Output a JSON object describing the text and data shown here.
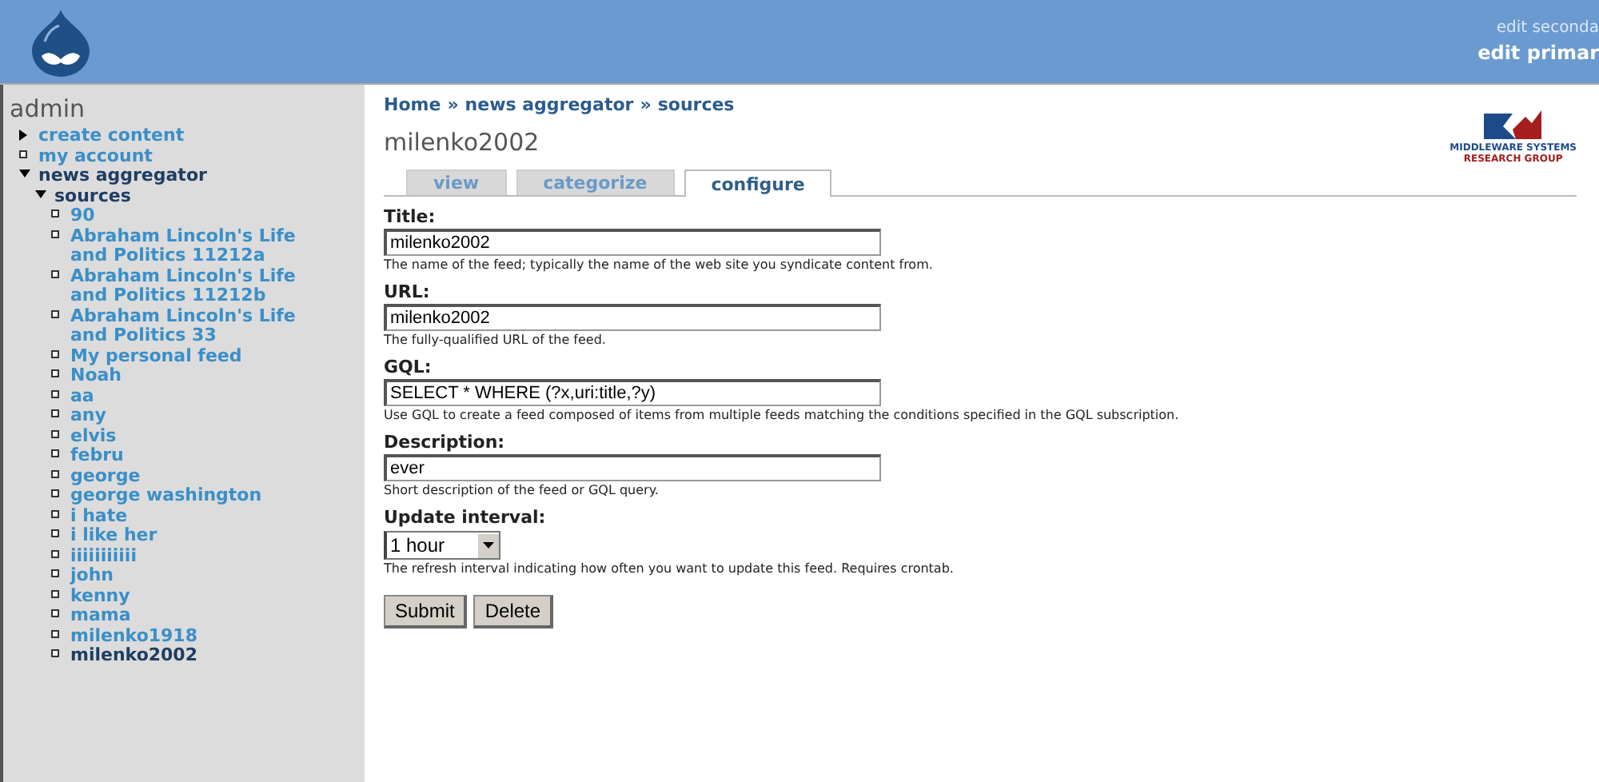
{
  "header": {
    "secondary_link": "edit seconda",
    "primary_link": "edit primar"
  },
  "sidebar": {
    "title": "admin",
    "items": [
      {
        "label": "create content",
        "kind": "collapsed",
        "active": false
      },
      {
        "label": "my account",
        "kind": "leaf",
        "active": false
      },
      {
        "label": "news aggregator",
        "kind": "expanded",
        "active": true,
        "children": [
          {
            "label": "sources",
            "kind": "expanded",
            "active": true,
            "children": [
              {
                "label": "90",
                "kind": "leaf",
                "active": false
              },
              {
                "label": "Abraham Lincoln's Life and Politics 11212a",
                "kind": "leaf",
                "active": false
              },
              {
                "label": "Abraham Lincoln's Life and Politics 11212b",
                "kind": "leaf",
                "active": false
              },
              {
                "label": "Abraham Lincoln's Life and Politics 33",
                "kind": "leaf",
                "active": false
              },
              {
                "label": "My personal feed",
                "kind": "leaf",
                "active": false
              },
              {
                "label": "Noah",
                "kind": "leaf",
                "active": false
              },
              {
                "label": "aa",
                "kind": "leaf",
                "active": false
              },
              {
                "label": "any",
                "kind": "leaf",
                "active": false
              },
              {
                "label": "elvis",
                "kind": "leaf",
                "active": false
              },
              {
                "label": "febru",
                "kind": "leaf",
                "active": false
              },
              {
                "label": "george",
                "kind": "leaf",
                "active": false
              },
              {
                "label": "george washington",
                "kind": "leaf",
                "active": false
              },
              {
                "label": "i hate",
                "kind": "leaf",
                "active": false
              },
              {
                "label": "i like her",
                "kind": "leaf",
                "active": false
              },
              {
                "label": "iiiiiiiiiii",
                "kind": "leaf",
                "active": false
              },
              {
                "label": "john",
                "kind": "leaf",
                "active": false
              },
              {
                "label": "kenny",
                "kind": "leaf",
                "active": false
              },
              {
                "label": "mama",
                "kind": "leaf",
                "active": false
              },
              {
                "label": "milenko1918",
                "kind": "leaf",
                "active": false
              },
              {
                "label": "milenko2002",
                "kind": "leaf",
                "active": true
              }
            ]
          }
        ]
      }
    ]
  },
  "breadcrumb": [
    "Home",
    "news aggregator",
    "sources"
  ],
  "breadcrumb_separator": "»",
  "page_title": "milenko2002",
  "logo": {
    "line_1": "MIDDLEWARE SYSTEMS",
    "line_2": "RESEARCH GROUP"
  },
  "tabs": [
    {
      "label": "view",
      "selected": false
    },
    {
      "label": "categorize",
      "selected": false
    },
    {
      "label": "configure",
      "selected": true
    }
  ],
  "form": {
    "fields": [
      {
        "kind": "text",
        "label": "Title:",
        "value": "milenko2002",
        "help": "The name of the feed; typically the name of the web site you syndicate content from."
      },
      {
        "kind": "text",
        "label": "URL:",
        "value": "milenko2002",
        "help": "The fully-qualified URL of the feed."
      },
      {
        "kind": "text",
        "label": "GQL:",
        "value": "SELECT * WHERE (?x,uri:title,?y)",
        "help": "Use GQL to create a feed composed of items from multiple feeds matching the conditions specified in the GQL subscription."
      },
      {
        "kind": "text",
        "label": "Description:",
        "value": "ever",
        "help": "Short description of the feed or GQL query."
      },
      {
        "kind": "select",
        "label": "Update interval:",
        "value": "1 hour",
        "help": "The refresh interval indicating how often you want to update this feed. Requires crontab."
      }
    ],
    "buttons": [
      "Submit",
      "Delete"
    ]
  }
}
